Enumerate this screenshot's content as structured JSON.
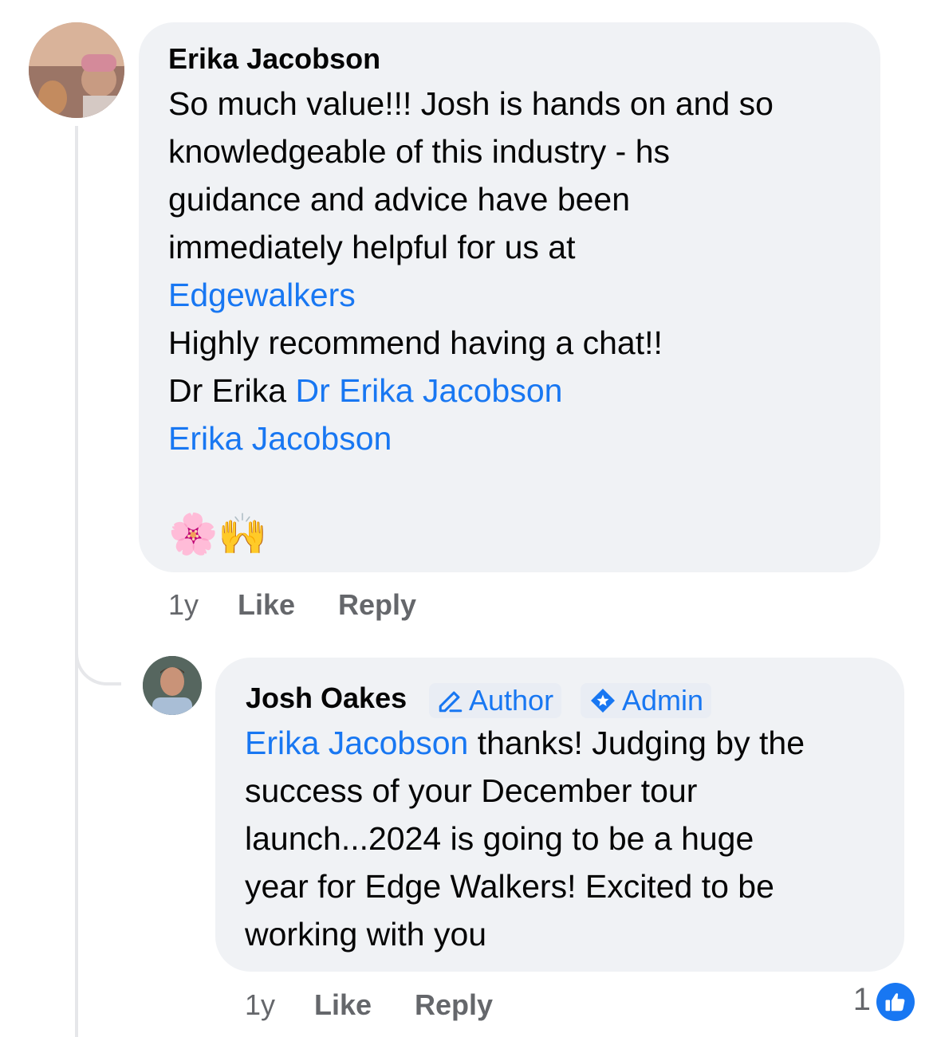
{
  "comment": {
    "author": "Erika Jacobson",
    "lines": [
      "So much value!!!  Josh is hands on and so",
      "knowledgeable of this industry - hs",
      "guidance and advice have been",
      "immediately helpful for us at"
    ],
    "link_edgewalkers": "Edgewalkers",
    "line_recommend": "Highly recommend having a chat!!",
    "sign_prefix": "Dr Erika",
    "sign_link": "Dr Erika Jacobson",
    "sign_link2": "Erika Jacobson",
    "emoji": "🌸🙌",
    "time": "1y",
    "like_label": "Like",
    "reply_label": "Reply"
  },
  "reply": {
    "author": "Josh Oakes",
    "badge_author": "Author",
    "badge_admin": "Admin",
    "mention": "Erika Jacobson",
    "first_line_rest": " thanks! Judging by the",
    "lines": [
      "success of your December tour",
      "launch...2024 is going to be a huge",
      "year for Edge Walkers! Excited to be",
      "working with you"
    ],
    "time": "1y",
    "like_label": "Like",
    "reply_label": "Reply",
    "reaction_count": "1"
  },
  "colors": {
    "link": "#1877f2",
    "bubble": "#f0f2f5",
    "meta": "#65676b"
  }
}
